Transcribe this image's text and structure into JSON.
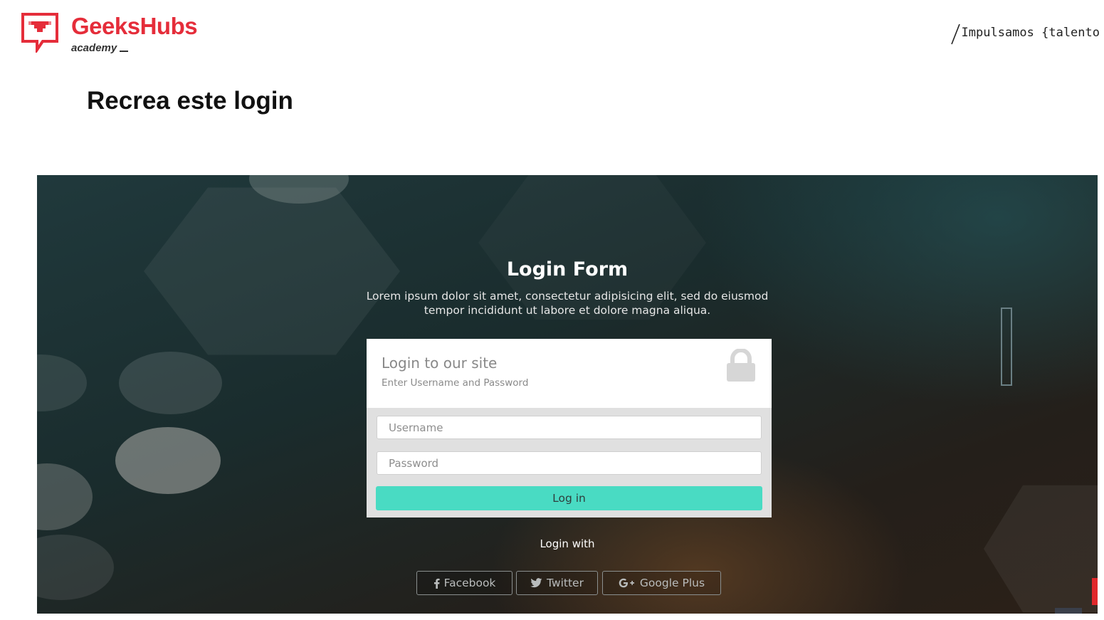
{
  "header": {
    "brand_name": "GeeksHubs",
    "brand_sub": "academy",
    "tagline": "Impulsamos {talento"
  },
  "page": {
    "heading": "Recrea este login"
  },
  "login_page": {
    "title": "Login Form",
    "description": "Lorem ipsum dolor sit amet, consectetur adipisicing elit, sed do eiusmod tempor incididunt ut labore et dolore magna aliqua.",
    "box": {
      "title": "Login to our site",
      "subtitle": "Enter Username and Password",
      "username_placeholder": "Username",
      "password_placeholder": "Password",
      "submit_label": "Log in"
    },
    "login_with": "Login with",
    "social": [
      {
        "label": "Facebook",
        "icon": "facebook-icon"
      },
      {
        "label": "Twitter",
        "icon": "twitter-icon"
      },
      {
        "label": "Google Plus",
        "icon": "google-plus-icon"
      }
    ]
  },
  "colors": {
    "brand": "#e52d3a",
    "accent_button": "#49dbc3",
    "panel_dark": "#1a2c2d"
  }
}
